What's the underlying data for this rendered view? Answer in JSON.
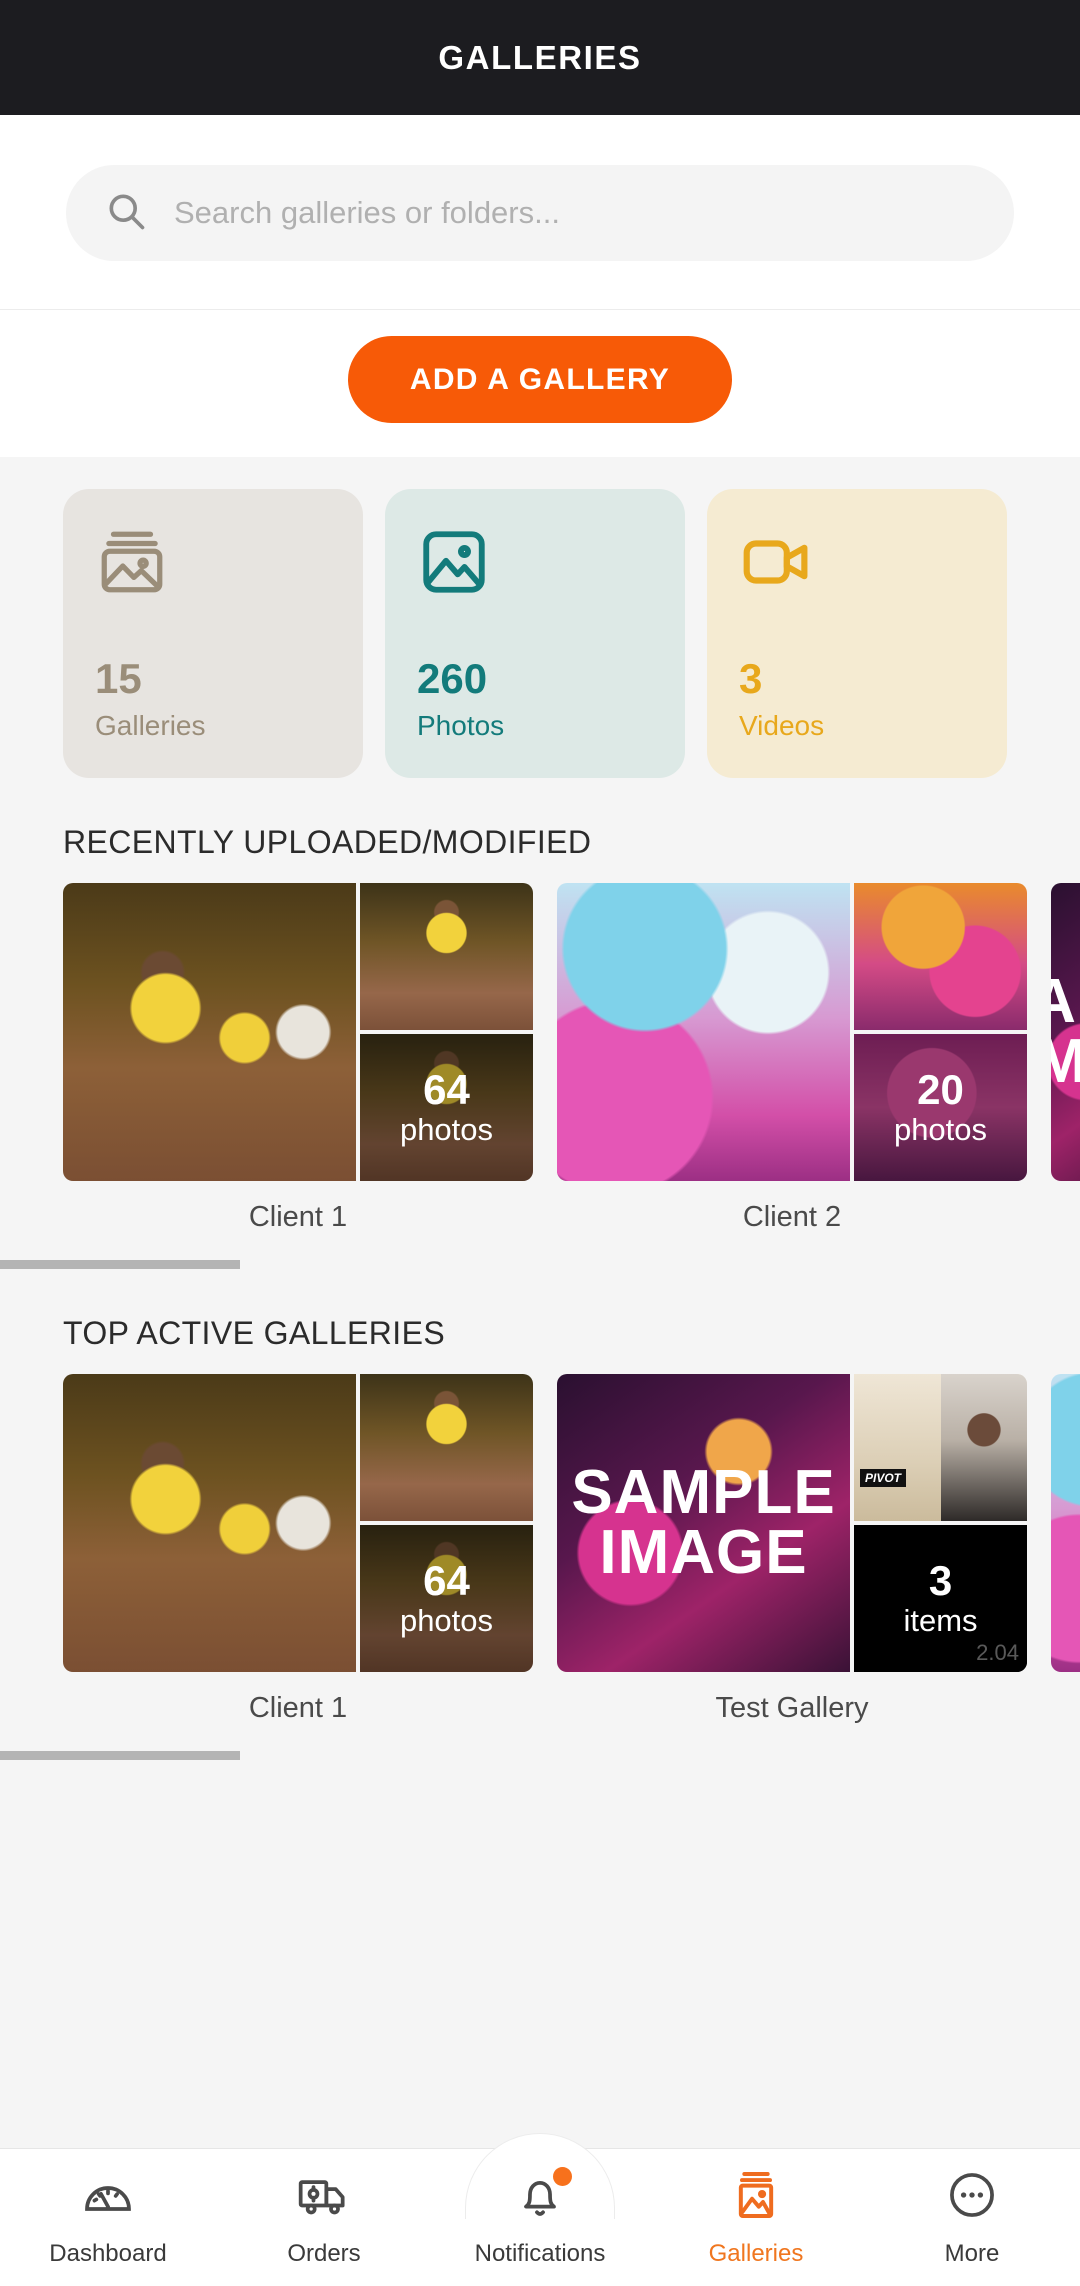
{
  "header": {
    "title": "GALLERIES"
  },
  "search": {
    "placeholder": "Search galleries or folders...",
    "value": "",
    "icon": "search-icon"
  },
  "cta": {
    "label": "ADD A GALLERY",
    "color": "#f75a07"
  },
  "stats": [
    {
      "count": "15",
      "label": "Galleries",
      "icon": "stacked-images-icon",
      "accent": "#9a8d79",
      "background": "#e7e4e0"
    },
    {
      "count": "260",
      "label": "Photos",
      "icon": "image-icon",
      "accent": "#137b7b",
      "background": "#dde9e6"
    },
    {
      "count": "3",
      "label": "Videos",
      "icon": "video-camera-icon",
      "accent": "#e8a81c",
      "background": "#f5ebd2"
    }
  ],
  "sections": [
    {
      "title": "RECENTLY UPLOADED/MODIFIED",
      "galleries": [
        {
          "name": "Client 1",
          "count_num": "64",
          "count_label": "photos"
        },
        {
          "name": "Client 2",
          "count_num": "20",
          "count_label": "photos"
        }
      ]
    },
    {
      "title": "TOP ACTIVE GALLERIES",
      "galleries": [
        {
          "name": "Client 1",
          "count_num": "64",
          "count_label": "photos"
        },
        {
          "name": "Test Gallery",
          "count_num": "3",
          "count_label": "items"
        }
      ]
    }
  ],
  "sample_image": {
    "line1": "SAMPLE",
    "line2": "IMAGE",
    "badge": "PIVOT",
    "ghost": "2.04"
  },
  "bottom_nav": {
    "items": [
      {
        "label": "Dashboard",
        "icon": "speedometer-icon",
        "active": false,
        "badge": false
      },
      {
        "label": "Orders",
        "icon": "truck-icon",
        "active": false,
        "badge": false
      },
      {
        "label": "Notifications",
        "icon": "bell-icon",
        "active": false,
        "badge": true
      },
      {
        "label": "Galleries",
        "icon": "stacked-images-icon",
        "active": true,
        "badge": false
      },
      {
        "label": "More",
        "icon": "ellipsis-circle-icon",
        "active": false,
        "badge": false
      }
    ],
    "active_color": "#f0761f"
  }
}
